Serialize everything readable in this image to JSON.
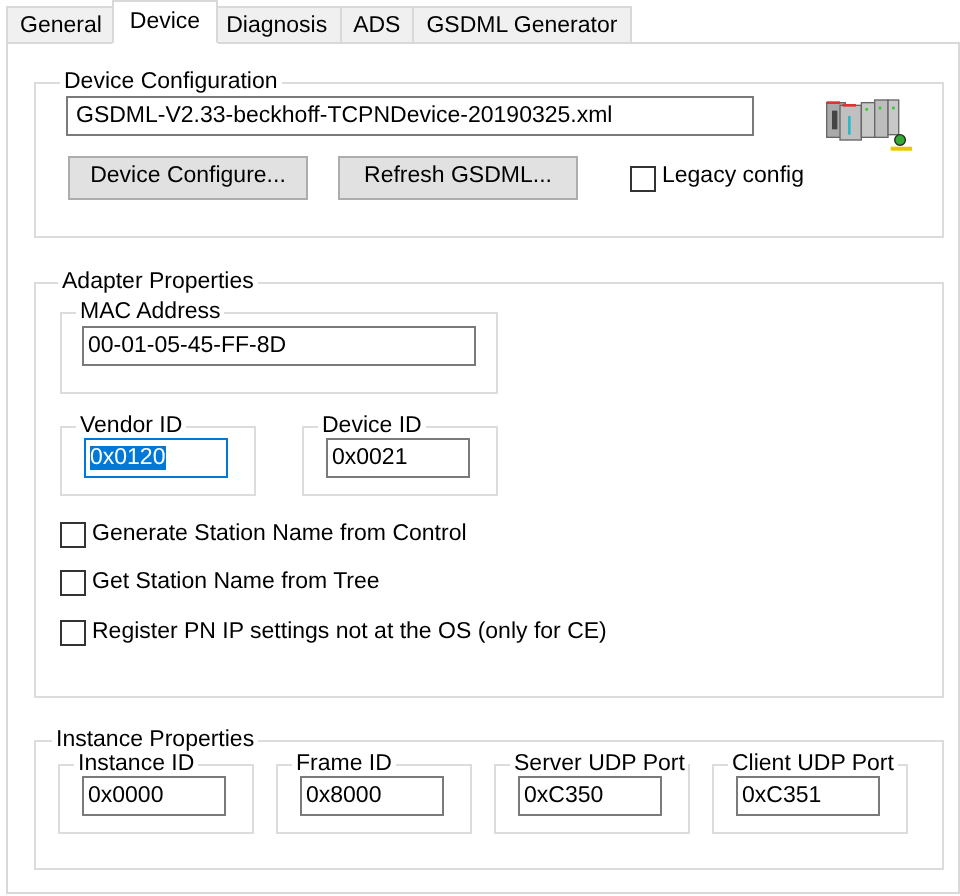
{
  "tabs": [
    {
      "label": "General",
      "selected": false
    },
    {
      "label": "Device",
      "selected": true
    },
    {
      "label": "Diagnosis",
      "selected": false
    },
    {
      "label": "ADS",
      "selected": false
    },
    {
      "label": "GSDML Generator",
      "selected": false
    }
  ],
  "device_configuration": {
    "title": "Device Configuration",
    "file": "GSDML-V2.33-beckhoff-TCPNDevice-20190325.xml",
    "buttons": [
      "Device Configure...",
      "Refresh GSDML..."
    ],
    "legacy_config": {
      "label": "Legacy config",
      "checked": false
    }
  },
  "adapter_properties": {
    "title": "Adapter Properties",
    "mac_address": {
      "title": "MAC Address",
      "value": "00-01-05-45-FF-8D",
      "text_selected": false
    },
    "ids": [
      {
        "title": "Vendor ID",
        "value": "0x0120",
        "text_selected": true
      },
      {
        "title": "Device ID",
        "value": "0x0021",
        "text_selected": false
      }
    ],
    "options": [
      {
        "label": "Generate Station Name from Control",
        "checked": false
      },
      {
        "label": "Get Station Name from Tree",
        "checked": false
      },
      {
        "label": "Register PN IP settings not at the OS (only for CE)",
        "checked": false
      }
    ]
  },
  "instance_properties": {
    "title": "Instance Properties",
    "fields": [
      {
        "title": "Instance ID",
        "value": "0x0000",
        "text_selected": false
      },
      {
        "title": "Frame ID",
        "value": "0x8000",
        "text_selected": false
      },
      {
        "title": "Server UDP Port",
        "value": "0xC350",
        "text_selected": false
      },
      {
        "title": "Client UDP Port",
        "value": "0xC351",
        "text_selected": false
      }
    ]
  }
}
